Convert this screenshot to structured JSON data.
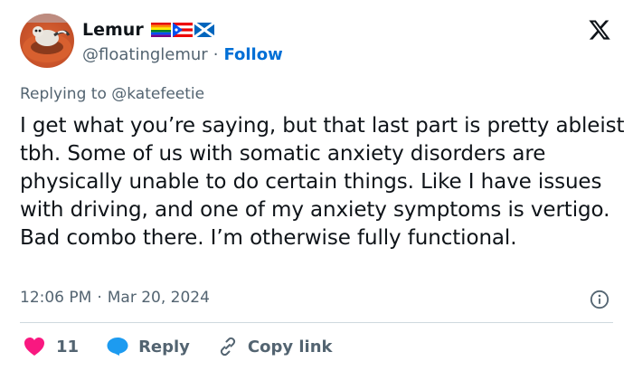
{
  "user": {
    "display_name": "Lemur",
    "handle": "@floatinglemur",
    "separator": "·",
    "follow_label": "Follow",
    "flags": [
      "rainbow-flag-icon",
      "puerto-rico-flag-icon",
      "scotland-flag-icon"
    ],
    "avatar_icon": "lemur-avatar"
  },
  "platform_logo": "x-logo-icon",
  "reply": {
    "prefix": "Replying to ",
    "mention": "@katefeetie"
  },
  "tweet": {
    "text": "I get what you’re saying, but that last part is pretty ableist tbh. Some of us with somatic anxiety disorders are physically unable to do certain things. Like I have issues with driving, and one of my anxiety symptoms is vertigo. Bad combo there. I’m otherwise fully functional.",
    "time": "12:06 PM",
    "separator": "·",
    "date": "Mar 20, 2024"
  },
  "actions": {
    "like_count": "11",
    "reply_label": "Reply",
    "copy_label": "Copy link"
  },
  "colors": {
    "text": "#0f1419",
    "secondary": "#536471",
    "link": "#006fd6",
    "like": "#f91880",
    "reply_icon": "#1d9bf0",
    "divider": "#cfd9de"
  }
}
